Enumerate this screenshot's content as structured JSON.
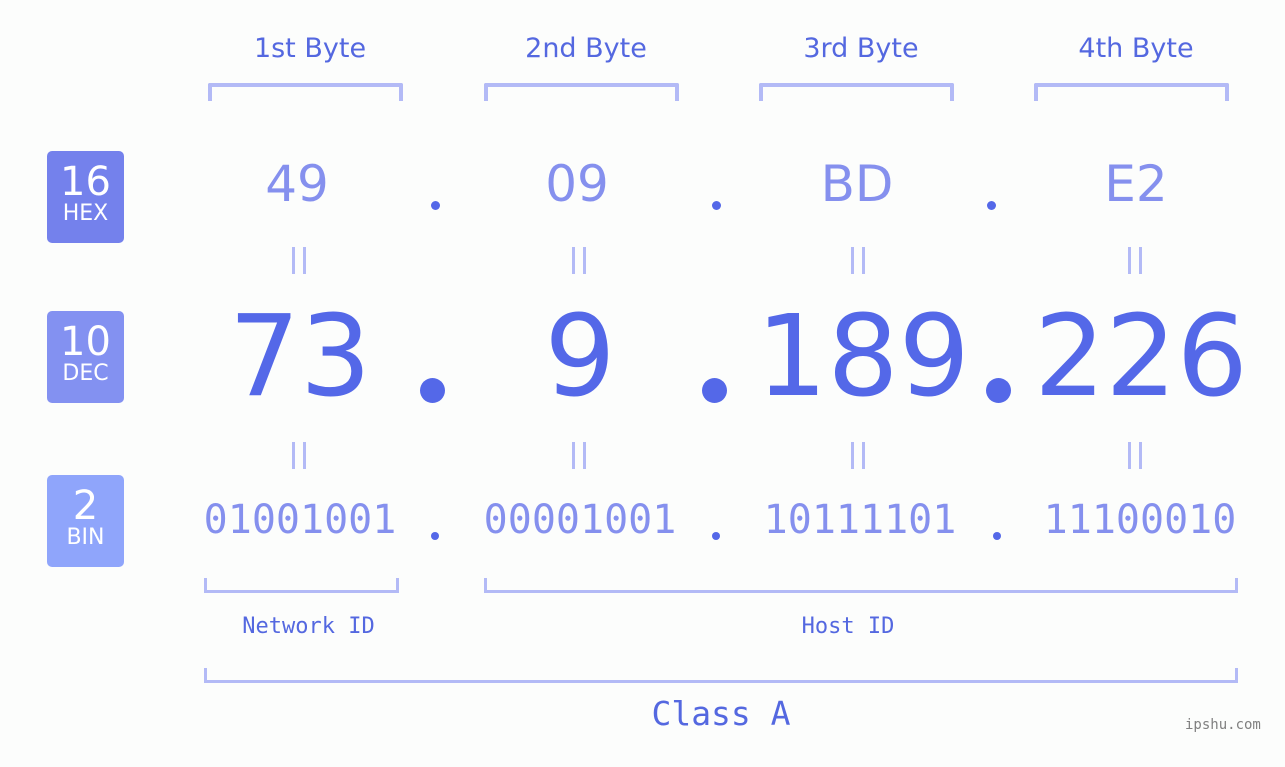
{
  "bytes": [
    {
      "header": "1st Byte",
      "hex": "49",
      "dec": "73",
      "bin": "01001001"
    },
    {
      "header": "2nd Byte",
      "hex": "09",
      "dec": "9",
      "bin": "00001001"
    },
    {
      "header": "3rd Byte",
      "hex": "BD",
      "dec": "189",
      "bin": "10111101"
    },
    {
      "header": "4th Byte",
      "hex": "E2",
      "dec": "226",
      "bin": "11100010"
    }
  ],
  "badges": {
    "hex": {
      "num": "16",
      "label": "HEX",
      "color": "#7481ec"
    },
    "dec": {
      "num": "10",
      "label": "DEC",
      "color": "#8391f1"
    },
    "bin": {
      "num": "2",
      "label": "BIN",
      "color": "#8fa5fb"
    }
  },
  "segments": {
    "network": "Network ID",
    "host": "Host ID",
    "class": "Class A"
  },
  "watermark": "ipshu.com",
  "colors": {
    "accent": "#5468e8",
    "light_value": "#8590ee",
    "bracket": "#b3baf6"
  }
}
